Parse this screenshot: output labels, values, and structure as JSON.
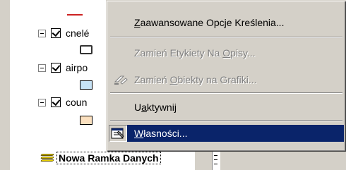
{
  "toc": {
    "layers": [
      {
        "label": "cnelé",
        "symbol": "outline-rectangle"
      },
      {
        "label": "airpo",
        "symbol_color": "#c6e2f5"
      },
      {
        "label": "coun",
        "symbol_color": "#fbe0bf"
      }
    ],
    "data_frame_label": "Nowa Ramka Danych"
  },
  "context_menu": {
    "items": [
      {
        "label": "Zaawansowane Opcje Kreślenia...",
        "mnemonic": "Z",
        "enabled": true
      },
      {
        "label": "Zamień Etykiety Na Opisy...",
        "mnemonic": "O",
        "enabled": false
      },
      {
        "label": "Zamień Obiekty na Grafiki...",
        "mnemonic": "O",
        "enabled": false,
        "icon": "convert-graphics-icon"
      },
      {
        "label": "Uaktywnij",
        "mnemonic": "a",
        "enabled": true
      },
      {
        "label": "Własności...",
        "mnemonic": "W",
        "enabled": true,
        "selected": true,
        "icon": "properties-icon"
      }
    ]
  },
  "colors": {
    "menu_highlight": "#0a246a",
    "menu_background": "#d4d0c8",
    "line_symbol": "#cc2222",
    "data_frame_icon": "#e8d000"
  }
}
